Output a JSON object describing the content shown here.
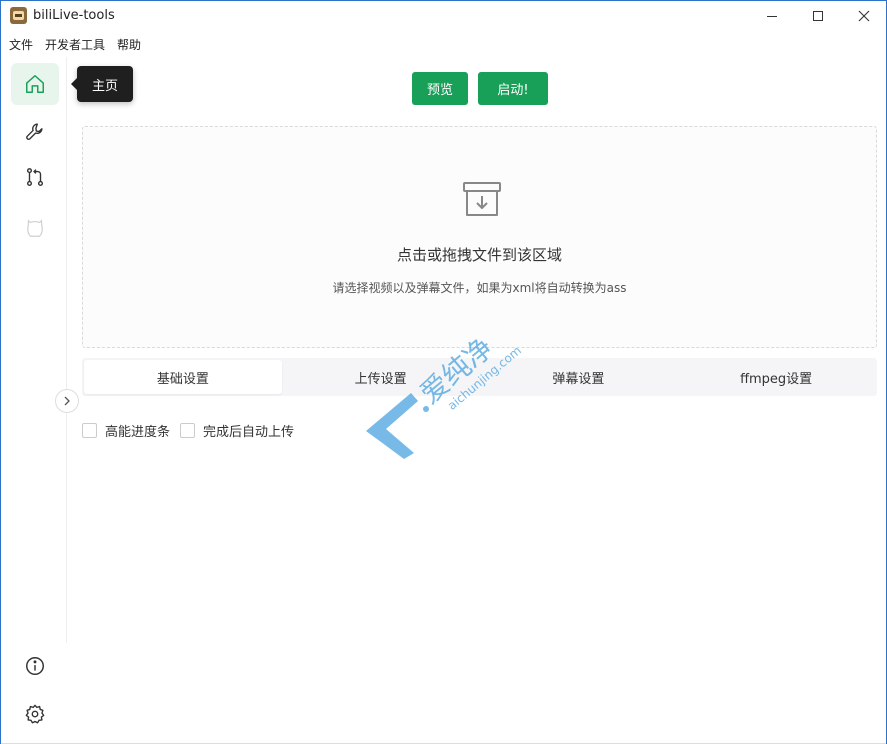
{
  "window": {
    "title": "biliLive-tools"
  },
  "menu": [
    "文件",
    "开发者工具",
    "帮助"
  ],
  "tooltip": "主页",
  "toolbar": {
    "preview": "预览",
    "start": "启动!"
  },
  "upload": {
    "title": "点击或拖拽文件到该区域",
    "subtitle": "请选择视频以及弹幕文件，如果为xml将自动转换为ass"
  },
  "tabs": [
    "基础设置",
    "上传设置",
    "弹幕设置",
    "ffmpeg设置"
  ],
  "checkboxes": [
    "高能进度条",
    "完成后自动上传"
  ],
  "watermark": {
    "cn": "爱纯净",
    "en": "aichunjing.com"
  },
  "colors": {
    "accent": "#18a058",
    "sidebar_active_bg": "#e8f5ec"
  }
}
